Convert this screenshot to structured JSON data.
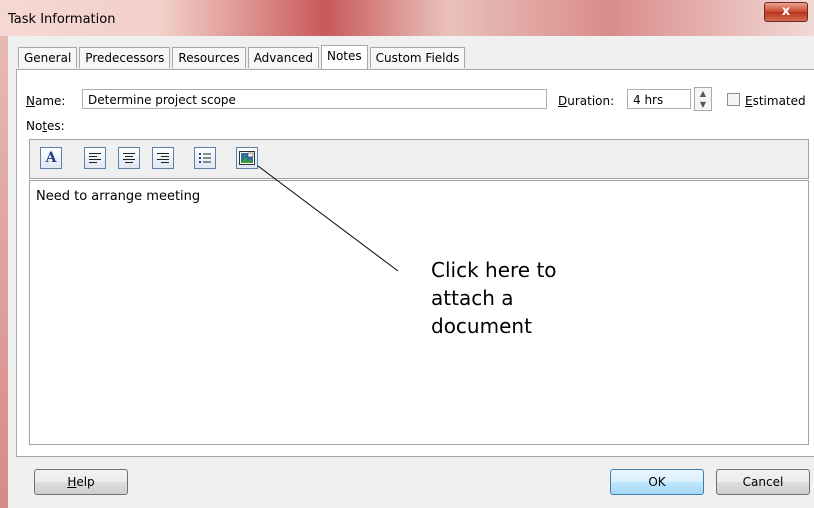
{
  "window": {
    "title": "Task Information",
    "close_label": "x"
  },
  "tabs": [
    {
      "label": "General"
    },
    {
      "label": "Predecessors"
    },
    {
      "label": "Resources"
    },
    {
      "label": "Advanced"
    },
    {
      "label": "Notes",
      "active": true
    },
    {
      "label": "Custom Fields"
    }
  ],
  "fields": {
    "name_label_ul": "N",
    "name_label_rest": "ame:",
    "name_value": "Determine project scope",
    "duration_label_ul": "D",
    "duration_label_rest": "uration:",
    "duration_value": "4 hrs",
    "estimated_label_ul": "E",
    "estimated_label_rest": "stimated",
    "estimated_checked": false,
    "notes_label_pre": "No",
    "notes_label_ul": "t",
    "notes_label_post": "es:"
  },
  "toolbar": {
    "font_icon_glyph": "A",
    "buttons": [
      "font-icon",
      "align-left-icon",
      "align-center-icon",
      "align-right-icon",
      "bullet-list-icon",
      "insert-object-icon"
    ]
  },
  "notes": {
    "text": "Need to arrange meeting"
  },
  "annotation": {
    "lines": [
      "Click here to",
      "attach a",
      "document"
    ]
  },
  "buttons": {
    "help_ul": "H",
    "help_rest": "elp",
    "ok": "OK",
    "cancel": "Cancel"
  },
  "colors": {
    "title_gradient_accent": "#c8595a",
    "close_button": "#c9472b",
    "ok_button": "#bee6fd"
  }
}
